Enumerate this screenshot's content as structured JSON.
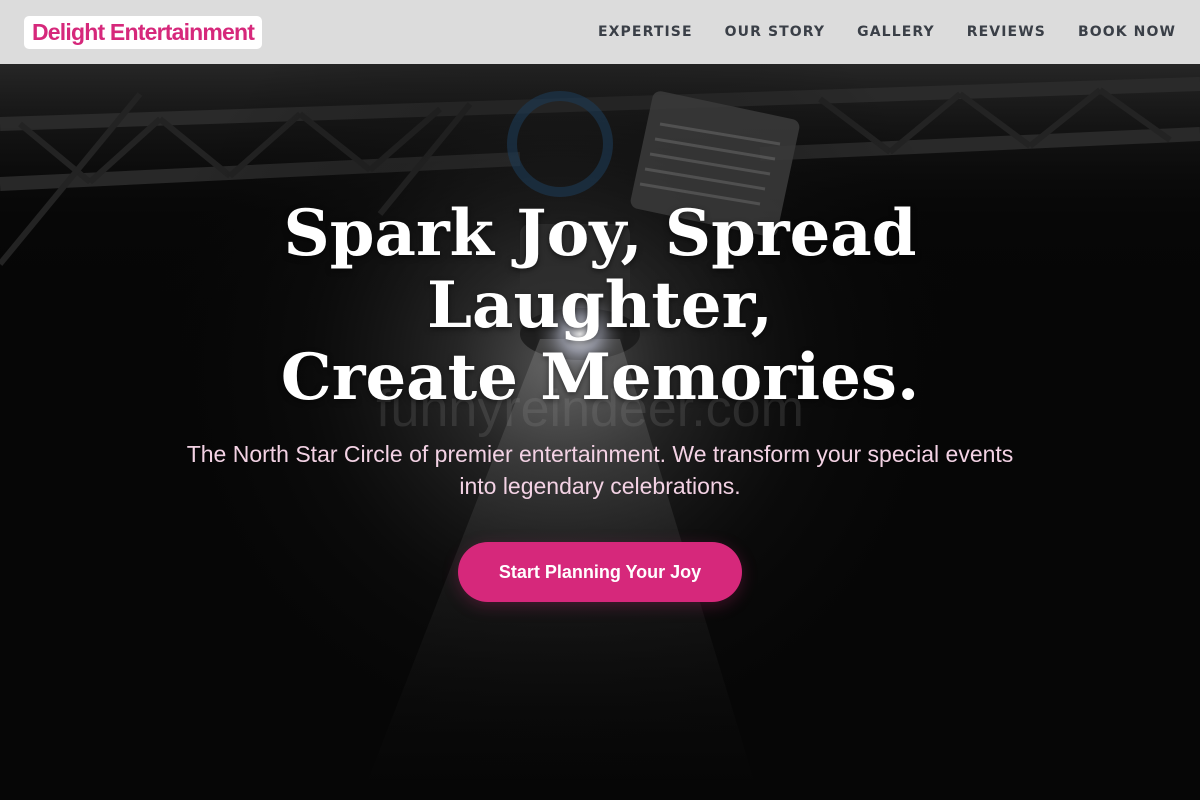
{
  "header": {
    "logo": "Delight Entertainment",
    "nav": [
      {
        "label": "EXPERTISE"
      },
      {
        "label": "OUR STORY"
      },
      {
        "label": "GALLERY"
      },
      {
        "label": "REVIEWS"
      },
      {
        "label": "BOOK NOW"
      }
    ]
  },
  "hero": {
    "headline_lines": [
      "Spark Joy, Spread",
      "Laughter,",
      "Create Memories."
    ],
    "subtitle": "The North Star Circle of premier entertainment. We transform your special events into legendary celebrations.",
    "cta_label": "Start Planning Your Joy",
    "watermark": "funnyreindeer.com"
  },
  "colors": {
    "accent": "#d6287b",
    "header_bg": "#dcdcdc",
    "nav_text": "#3a3f47",
    "hero_bg": "#060606",
    "subtitle_text": "#f3d2e4"
  }
}
